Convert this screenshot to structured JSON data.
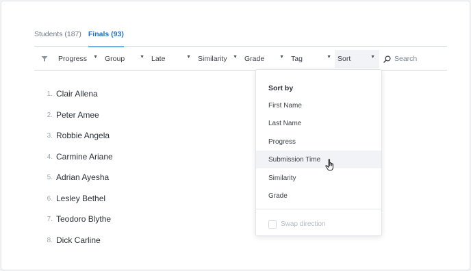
{
  "tabs": [
    {
      "label": "Students (187)",
      "active": false
    },
    {
      "label": "Finals (93)",
      "active": true
    }
  ],
  "filters": {
    "progress": "Progress",
    "group": "Group",
    "late": "Late",
    "similarity": "Similarity",
    "grade": "Grade",
    "tag": "Tag",
    "sort": "Sort",
    "search_placeholder": "Search"
  },
  "students": [
    {
      "num": "1.",
      "name": "Clair Allena"
    },
    {
      "num": "2.",
      "name": "Peter Amee"
    },
    {
      "num": "3.",
      "name": "Robbie Angela"
    },
    {
      "num": "4.",
      "name": "Carmine Ariane"
    },
    {
      "num": "5.",
      "name": "Adrian Ayesha"
    },
    {
      "num": "6.",
      "name": "Lesley Bethel"
    },
    {
      "num": "7.",
      "name": "Teodoro Blythe"
    },
    {
      "num": "8.",
      "name": "Dick Carline"
    }
  ],
  "sort_menu": {
    "title": "Sort by",
    "options": [
      "First Name",
      "Last Name",
      "Progress",
      "Submission Time",
      "Similarity",
      "Grade"
    ],
    "hovered": "Submission Time",
    "swap_label": "Swap direction",
    "swap_checked": false
  },
  "colors": {
    "accent": "#1f74c7",
    "text": "#2b2f36",
    "muted": "#9aa3ad",
    "hover_bg": "#f1f3f6"
  }
}
